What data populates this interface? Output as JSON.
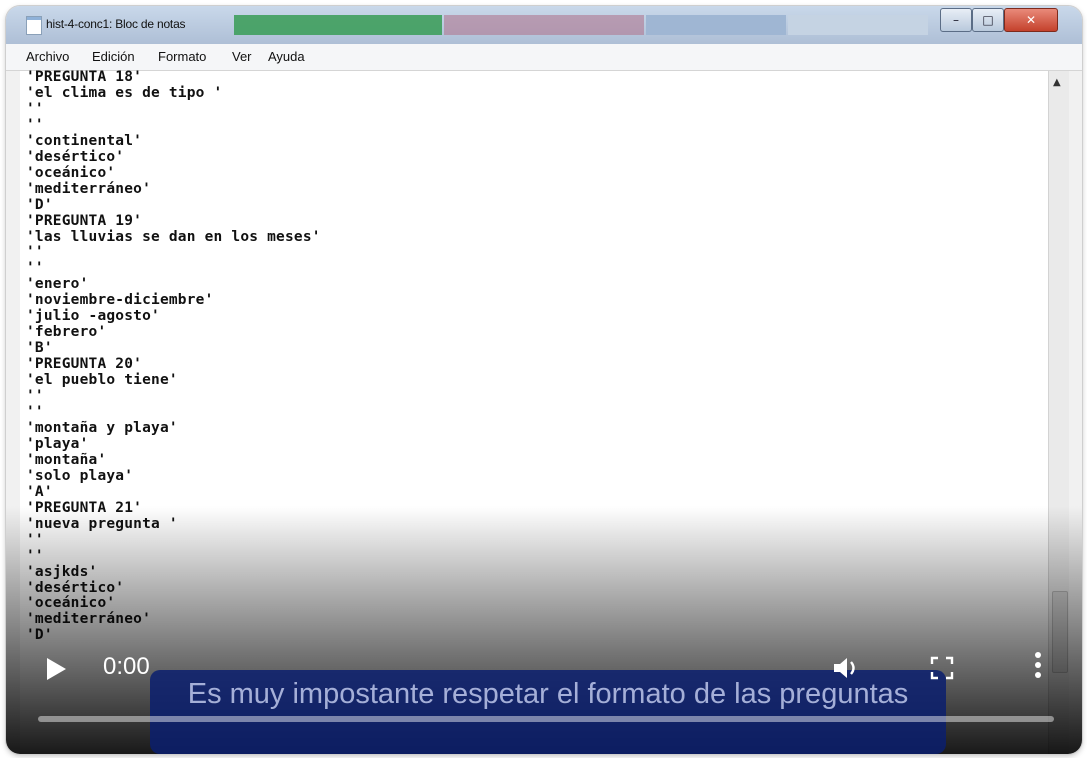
{
  "window": {
    "title": "hist-4-conc1: Bloc de notas"
  },
  "menu": [
    "Archivo",
    "Edición",
    "Formato",
    "Ver",
    "Ayuda"
  ],
  "editor": {
    "lines": [
      "'PREGUNTA 18'",
      "'el clima es de tipo '",
      "''",
      "''",
      "'continental'",
      "'desértico'",
      "'oceánico'",
      "'mediterráneo'",
      "'D'",
      "'PREGUNTA 19'",
      "'las lluvias se dan en los meses'",
      "''",
      "''",
      "'enero'",
      "'noviembre-diciembre'",
      "'julio -agosto'",
      "'febrero'",
      "'B'",
      "'PREGUNTA 20'",
      "'el pueblo tiene'",
      "''",
      "''",
      "'montaña y playa'",
      "'playa'",
      "'montaña'",
      "'solo playa'",
      "'A'",
      "'PREGUNTA 21'",
      "'nueva pregunta '",
      "''",
      "''",
      "'asjkds'",
      "'desértico'",
      "'oceánico'",
      "'mediterráneo'",
      "'D'"
    ]
  },
  "video": {
    "time": "0:00",
    "caption": "Es muy impostante respetar el formato de las preguntas",
    "progress": 0
  },
  "icons": {
    "play": "play-icon",
    "volume": "volume-icon",
    "fullscreen": "fullscreen-icon",
    "more": "more-options-icon",
    "app": "notepad-icon"
  }
}
